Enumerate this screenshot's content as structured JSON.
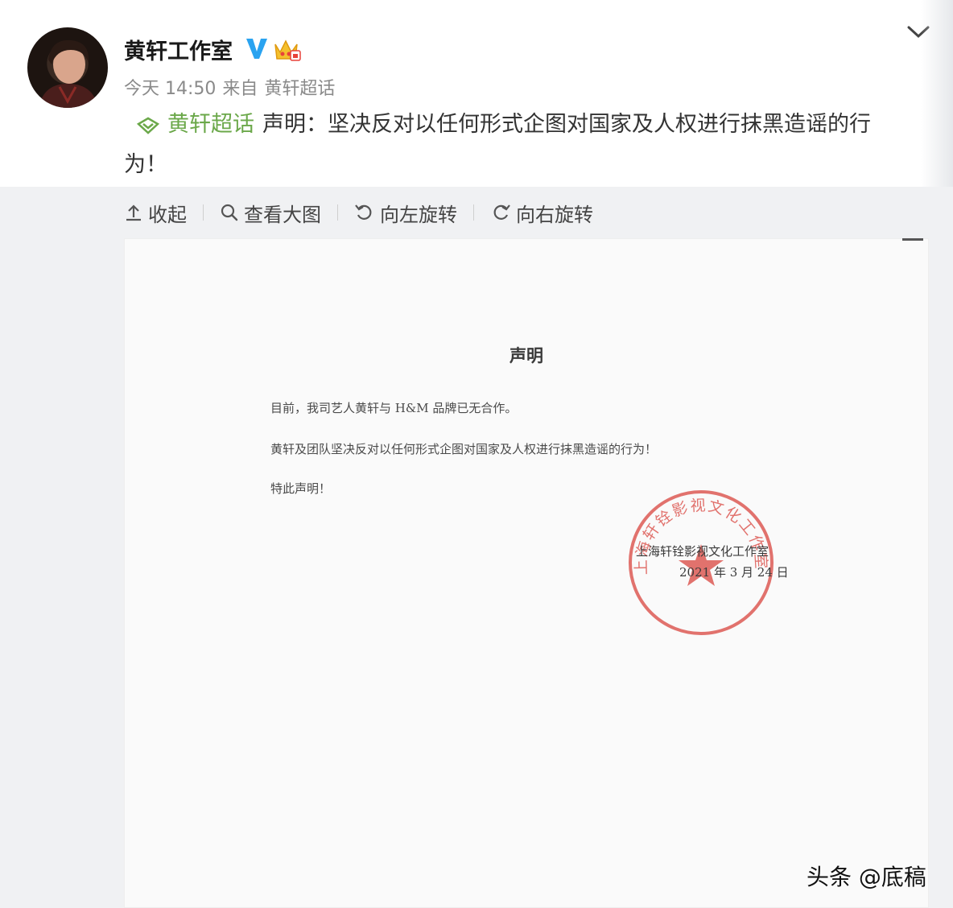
{
  "post": {
    "username": "黄轩工作室",
    "time": "今天 14:50",
    "from_label": "来自",
    "source": "黄轩超话",
    "supertopic": "黄轩超话",
    "text": "声明：坚决反对以任何形式企图对国家及人权进行抹黑造谣的行为！"
  },
  "toolbar": {
    "collapse": "收起",
    "view_large": "查看大图",
    "rotate_left": "向左旋转",
    "rotate_right": "向右旋转"
  },
  "document": {
    "title": "声明",
    "paragraphs": [
      "目前，我司艺人黄轩与 H&M 品牌已无合作。",
      "黄轩及团队坚决反对以任何形式企图对国家及人权进行抹黑造谣的行为！",
      "特此声明！"
    ],
    "signature_org": "上海轩铨影视文化工作室",
    "signature_date": "2021 年 3 月 24 日",
    "seal_text": "上海轩铨影视文化工作室"
  },
  "watermark": "头条 @底稿",
  "colors": {
    "supertopic_green": "#6ba84a",
    "verified_blue": "#2aa3f0",
    "seal_red": "#d9453f"
  },
  "icons": {
    "verified": "verified-v-icon",
    "crown": "crown-icon",
    "expand": "chevron-down-icon",
    "supertopic": "diamond-icon",
    "collapse": "arrow-up-icon",
    "view_large": "search-icon",
    "rotate_left": "rotate-left-icon",
    "rotate_right": "rotate-right-icon"
  }
}
